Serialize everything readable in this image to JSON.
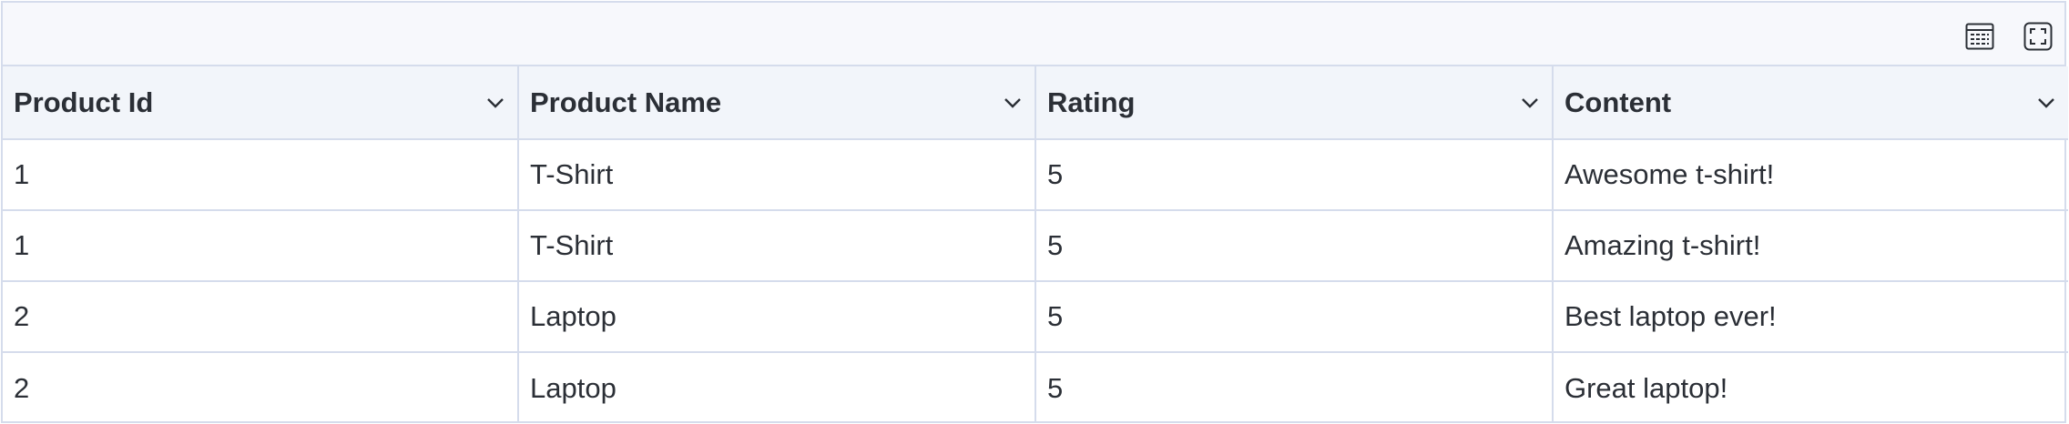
{
  "toolbar": {
    "buttons": [
      {
        "icon": "table-view-icon"
      },
      {
        "icon": "fullscreen-icon"
      }
    ]
  },
  "table": {
    "columns": [
      "Product Id",
      "Product Name",
      "Rating",
      "Content"
    ],
    "rows": [
      [
        "1",
        "T-Shirt",
        "5",
        "Awesome t-shirt!"
      ],
      [
        "1",
        "T-Shirt",
        "5",
        "Amazing t-shirt!"
      ],
      [
        "2",
        "Laptop",
        "5",
        "Best laptop ever!"
      ],
      [
        "2",
        "Laptop",
        "5",
        "Great laptop!"
      ]
    ]
  },
  "colors": {
    "border": "#d5dcec",
    "header_bg": "#f2f5fa",
    "toolbar_bg": "#f7f8fc",
    "text": "#2b2f36"
  }
}
